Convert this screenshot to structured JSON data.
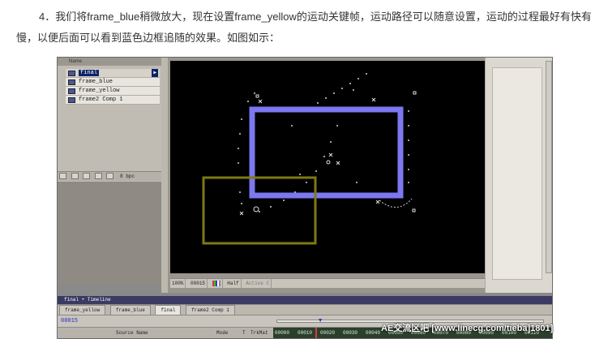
{
  "intro_text": "4．我们将frame_blue稍微放大，现在设置frame_yellow的运动关键帧，运动路径可以随意设置，运动的过程最好有快有慢，以便后面可以看到蓝色边框追随的效果。如图如示：",
  "project": {
    "header": "Name",
    "items": [
      {
        "label": "final",
        "selected": true
      },
      {
        "label": "frame_blue",
        "selected": false
      },
      {
        "label": "frame_yellow",
        "selected": false
      },
      {
        "label": "frame2 Comp 1",
        "selected": false
      }
    ],
    "bpc_label": "8 bpc"
  },
  "viewer": {
    "zoom": "100%",
    "timecode": "00015",
    "resolution": "Half",
    "camera": "Active C"
  },
  "timeline": {
    "title": "final • Timeline",
    "tabs": [
      "frame_yellow",
      "frame_blue",
      "final",
      "frame2 Comp 1"
    ],
    "active_tab": "final",
    "timecode": "00015",
    "columns": {
      "source_name": "Source Name",
      "mode": "Mode",
      "t": "T",
      "trkmat": "TrkMat"
    },
    "frame_labels": [
      "00000",
      "00010",
      "00020",
      "00030",
      "00040",
      "00050",
      "00060",
      "00070",
      "00080",
      "00090",
      "00100",
      "00110"
    ]
  },
  "colors": {
    "frame_blue": "#7b78f0",
    "frame_yellow": "#7d7a12",
    "canvas": "#000000"
  },
  "watermark": "AE交流区吧 [www.linecg.com/tieba]1801]"
}
